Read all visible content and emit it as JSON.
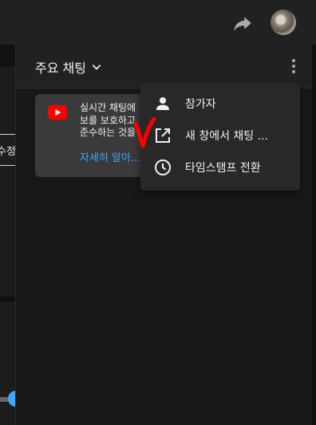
{
  "left_panel": {
    "button_fragment": "수정"
  },
  "chat": {
    "title": "주요 채팅",
    "notice": {
      "lines": [
        "실시간 채팅에",
        "보를 보호하고",
        "준수하는 것을"
      ],
      "link": "자세히 알아..."
    },
    "menu": {
      "items": [
        {
          "icon": "person-icon",
          "label": "참가자"
        },
        {
          "icon": "open-in-new-icon",
          "label": "새 창에서 채팅 ..."
        },
        {
          "icon": "clock-icon",
          "label": "타임스탬프 전환"
        }
      ]
    }
  },
  "colors": {
    "accent": "#3ea6ff",
    "annotation": "#ff0000",
    "youtube": "#ff0000"
  }
}
